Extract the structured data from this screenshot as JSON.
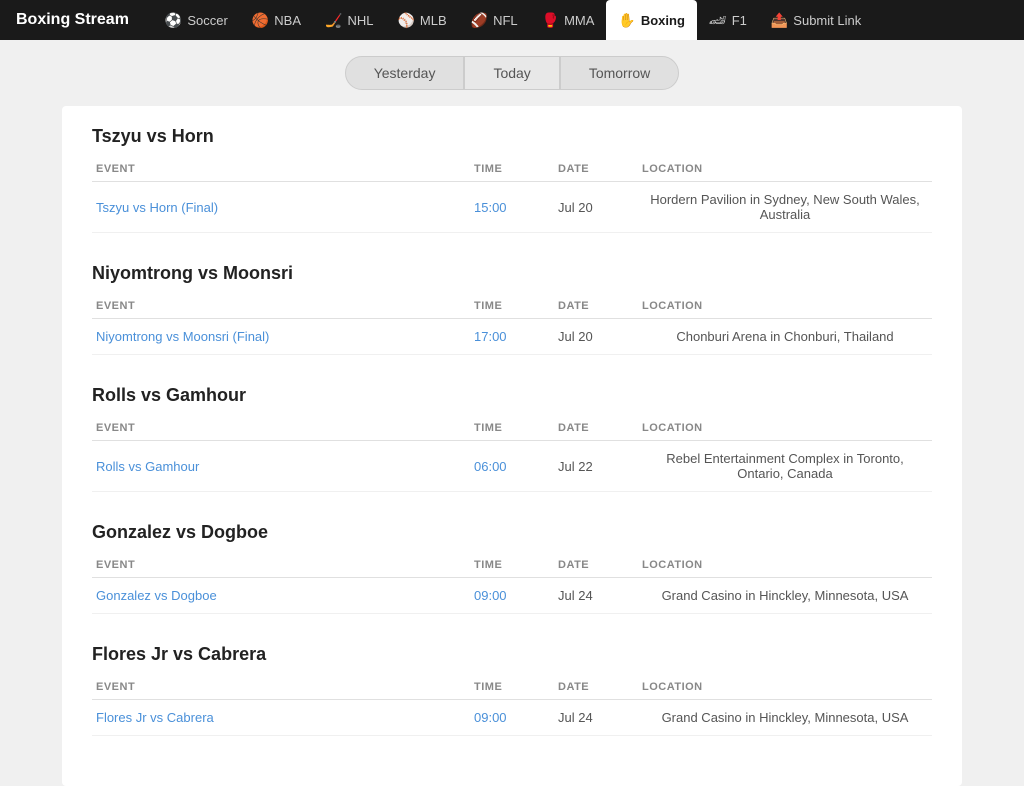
{
  "brand": "Boxing Stream",
  "nav": {
    "items": [
      {
        "label": "Soccer",
        "icon": "⚽",
        "active": false
      },
      {
        "label": "NBA",
        "icon": "🏀",
        "active": false
      },
      {
        "label": "NHL",
        "icon": "🏒",
        "active": false
      },
      {
        "label": "MLB",
        "icon": "⚾",
        "active": false
      },
      {
        "label": "NFL",
        "icon": "🏈",
        "active": false
      },
      {
        "label": "MMA",
        "icon": "🥊",
        "active": false
      },
      {
        "label": "Boxing",
        "icon": "✋",
        "active": true
      },
      {
        "label": "F1",
        "icon": "🏎",
        "active": false
      },
      {
        "label": "Submit Link",
        "icon": "📤",
        "active": false
      }
    ]
  },
  "filter": {
    "buttons": [
      "Yesterday",
      "Today",
      "Tomorrow"
    ],
    "active": "Today"
  },
  "columns": {
    "event": "EVENT",
    "time": "TIME",
    "date": "DATE",
    "location": "LOCATION"
  },
  "sections": [
    {
      "title": "Tszyu vs Horn",
      "rows": [
        {
          "event": "Tszyu vs Horn (Final)",
          "time": "15:00",
          "date": "Jul 20",
          "location": "Hordern Pavilion in Sydney, New South Wales, Australia"
        }
      ]
    },
    {
      "title": "Niyomtrong vs Moonsri",
      "rows": [
        {
          "event": "Niyomtrong vs Moonsri (Final)",
          "time": "17:00",
          "date": "Jul 20",
          "location": "Chonburi Arena in Chonburi, Thailand"
        }
      ]
    },
    {
      "title": "Rolls vs Gamhour",
      "rows": [
        {
          "event": "Rolls vs Gamhour",
          "time": "06:00",
          "date": "Jul 22",
          "location": "Rebel Entertainment Complex in Toronto, Ontario, Canada"
        }
      ]
    },
    {
      "title": "Gonzalez vs Dogboe",
      "rows": [
        {
          "event": "Gonzalez vs Dogboe",
          "time": "09:00",
          "date": "Jul 24",
          "location": "Grand Casino in Hinckley, Minnesota, USA"
        }
      ]
    },
    {
      "title": "Flores Jr vs Cabrera",
      "rows": [
        {
          "event": "Flores Jr vs Cabrera",
          "time": "09:00",
          "date": "Jul 24",
          "location": "Grand Casino in Hinckley, Minnesota, USA"
        }
      ]
    }
  ]
}
